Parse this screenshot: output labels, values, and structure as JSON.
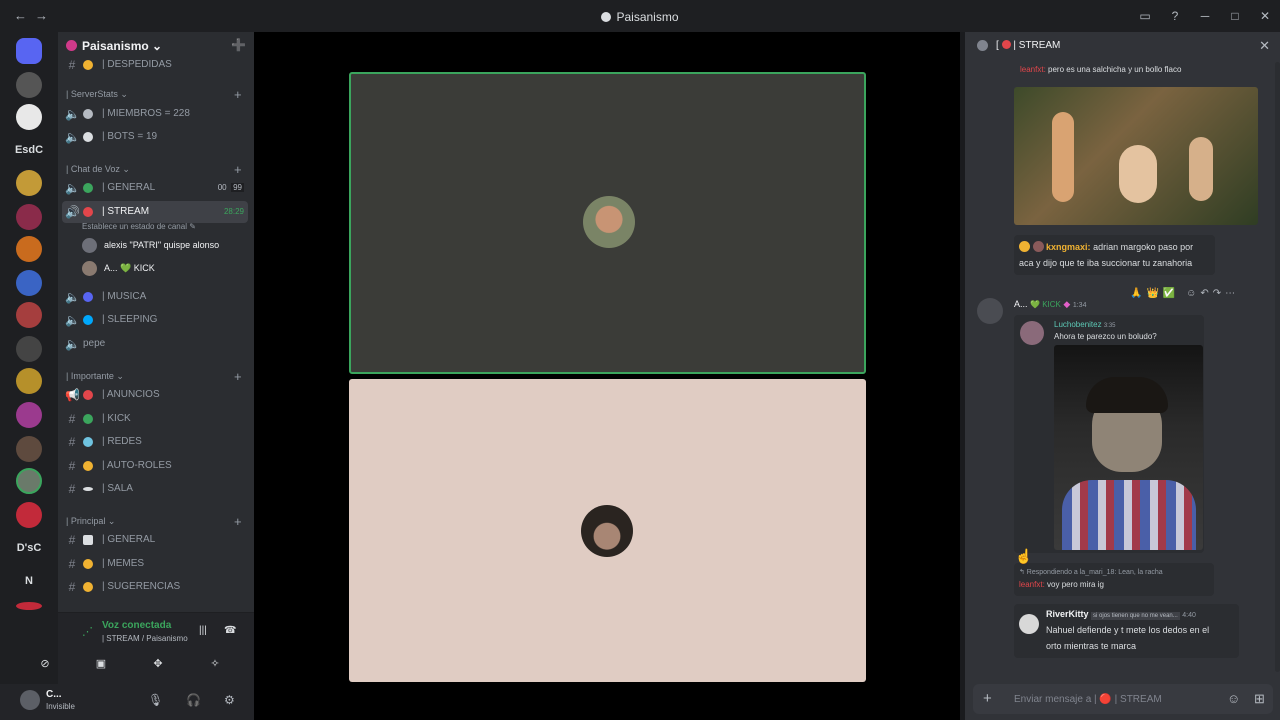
{
  "window": {
    "nav_back": "←",
    "nav_forward": "→",
    "title": "Paisanismo",
    "controls": [
      "▭",
      "?",
      "─",
      "□",
      "✕"
    ]
  },
  "guilds": {
    "text_servers": [
      "EsdC",
      "D'sC",
      "N"
    ]
  },
  "server": {
    "name": "Paisanismo ⌄",
    "invite_icon": "person-add-icon"
  },
  "channels": {
    "top_partial": "| DESPEDIDAS",
    "categories": [
      {
        "label": "| ServerStats ⌄"
      },
      {
        "label": "| Chat de Voz ⌄"
      },
      {
        "label": "| Importante ⌄"
      },
      {
        "label": "| Principal ⌄"
      }
    ],
    "stats": [
      {
        "name": "| MIEMBROS = 228"
      },
      {
        "name": "| BOTS = 19"
      }
    ],
    "voice": [
      {
        "name": "| GENERAL",
        "tag1": "00",
        "tag2": "99"
      },
      {
        "name": "| STREAM",
        "timer": "28:29",
        "status": "Establece un estado de canal ✎"
      },
      {
        "name": "| MUSICA"
      },
      {
        "name": "| SLEEPING"
      },
      {
        "name": "pepe"
      }
    ],
    "voice_users": [
      {
        "name": "alexis \"PATRI\" quispe alonso"
      },
      {
        "name": "A... 💚 KICK"
      }
    ],
    "important": [
      {
        "name": "| ANUNCIOS"
      },
      {
        "name": "| KICK"
      },
      {
        "name": "| REDES"
      },
      {
        "name": "| AUTO-ROLES"
      },
      {
        "name": "| SALA"
      }
    ],
    "main": [
      {
        "name": "| GENERAL"
      },
      {
        "name": "| MEMES"
      },
      {
        "name": "| SUGERENCIAS"
      }
    ]
  },
  "voice_panel": {
    "title": "Voz conectada",
    "subtitle": "| STREAM / Paisanismo"
  },
  "user": {
    "name": "C...",
    "status": "Invisible"
  },
  "chat": {
    "header": "| STREAM",
    "m1": {
      "author": "leanfxt:",
      "text": " pero es una salchicha y un bollo flaco"
    },
    "m2": {
      "author": "kxngmaxi:",
      "line1": " adrian margoko paso por",
      "line2": "aca y dijo que te iba succionar tu zanahoria"
    },
    "m3": {
      "author": "A...",
      "badge": "💚 KICK",
      "time": "1:34"
    },
    "quoted": {
      "author": "Luchobenitez",
      "time": "3:35",
      "text": "Ahora te parezco un boludo?"
    },
    "m4": {
      "reply": "↰ Respondiendo a la_mari_18: Lean, la racha",
      "author": "leanfxt:",
      "text": " voy pero mira ig"
    },
    "m5": {
      "author": "RiverKitty",
      "tag": "si ojos tienen que no me vean...",
      "time": "4:40",
      "line1": "Nahuel defiende y t mete los dedos en el",
      "line2": "orto mientras te marca"
    },
    "input_placeholder": "Enviar mensaje a | 🔴 | STREAM"
  },
  "colors": {
    "accent_green": "#3ba55d",
    "mention_red": "#e2464b",
    "name_yellow": "#f0b232"
  }
}
